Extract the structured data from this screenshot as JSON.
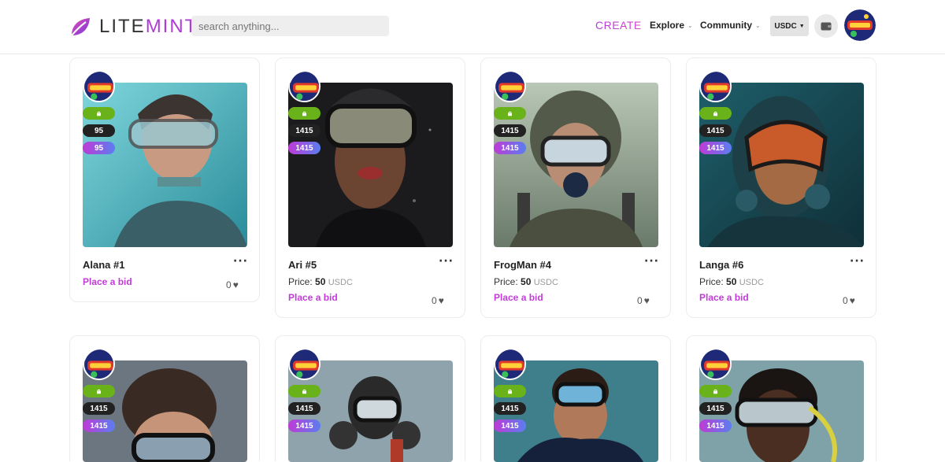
{
  "header": {
    "logo_prefix": "LITE",
    "logo_suffix": "MINT",
    "search_placeholder": "search anything...",
    "create_label": "CREATE",
    "explore_label": "Explore",
    "community_label": "Community",
    "currency_label": "USDC",
    "brand_color": "#b03bd8"
  },
  "cards": [
    {
      "name": "Alana #1",
      "lock_icon": "lock-icon",
      "count_a": "95",
      "count_b": "95",
      "price_label": "",
      "price_value": "",
      "price_currency": "",
      "bid_label": "Place a bid",
      "likes": "0"
    },
    {
      "name": "Ari #5",
      "lock_icon": "lock-icon",
      "count_a": "1415",
      "count_b": "1415",
      "price_label": "Price:",
      "price_value": "50",
      "price_currency": "USDC",
      "bid_label": "Place a bid",
      "likes": "0"
    },
    {
      "name": "FrogMan #4",
      "lock_icon": "lock-icon",
      "count_a": "1415",
      "count_b": "1415",
      "price_label": "Price:",
      "price_value": "50",
      "price_currency": "USDC",
      "bid_label": "Place a bid",
      "likes": "0"
    },
    {
      "name": "Langa #6",
      "lock_icon": "lock-icon",
      "count_a": "1415",
      "count_b": "1415",
      "price_label": "Price:",
      "price_value": "50",
      "price_currency": "USDC",
      "bid_label": "Place a bid",
      "likes": "0"
    },
    {
      "name": "",
      "lock_icon": "lock-icon",
      "count_a": "1415",
      "count_b": "1415"
    },
    {
      "name": "",
      "lock_icon": "lock-icon",
      "count_a": "1415",
      "count_b": "1415"
    },
    {
      "name": "",
      "lock_icon": "lock-icon",
      "count_a": "1415",
      "count_b": "1415"
    },
    {
      "name": "",
      "lock_icon": "lock-icon",
      "count_a": "1415",
      "count_b": "1415"
    }
  ]
}
